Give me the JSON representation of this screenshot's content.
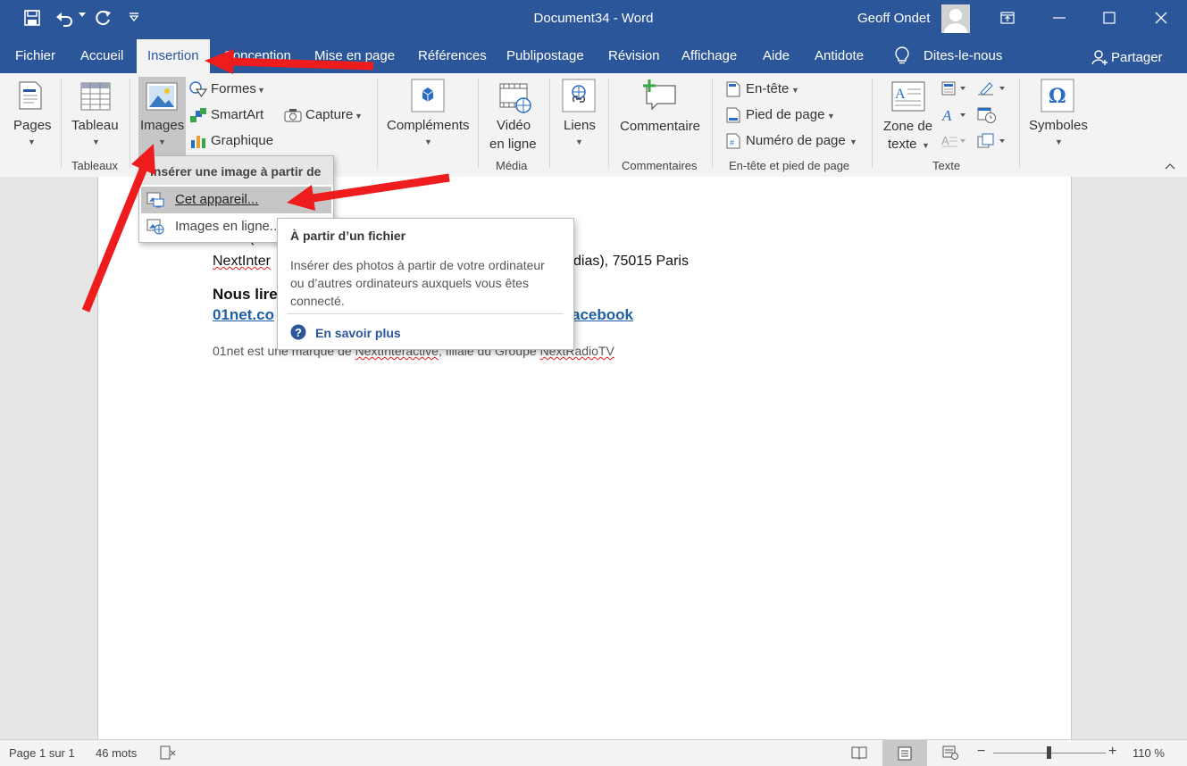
{
  "window": {
    "title": "Document34  -  Word",
    "user_name": "Geoff Ondet"
  },
  "menu_tabs": [
    "Fichier",
    "Accueil",
    "Insertion",
    "Conception",
    "Mise en page",
    "Références",
    "Publipostage",
    "Révision",
    "Affichage",
    "Aide",
    "Antidote"
  ],
  "active_tab": "Insertion",
  "tell_me": "Dites-le-nous",
  "share": "Partager",
  "ribbon": {
    "pages": "Pages",
    "tableau": "Tableau",
    "group_tableaux": "Tableaux",
    "images": "Images",
    "formes": "Formes",
    "smartart": "SmartArt",
    "capture": "Capture",
    "graphique": "Graphique",
    "complements": "Compléments",
    "video_line1": "Vidéo",
    "video_line2": "en ligne",
    "group_media": "Média",
    "liens": "Liens",
    "commentaire": "Commentaire",
    "group_commentaires": "Commentaires",
    "entete": "En-tête",
    "pied_de_page": "Pied de page",
    "numero_de_page": "Numéro de page",
    "group_entete": "En-tête et pied de page",
    "zone_line1": "Zone de",
    "zone_line2": "texte",
    "group_texte": "Texte",
    "symboles": "Symboles"
  },
  "images_dropdown": {
    "header": "Insérer une image à partir de",
    "items": [
      "Cet appareil...",
      "Images en ligne..."
    ]
  },
  "tooltip": {
    "title": "À partir d’un fichier",
    "body": "Insérer des photos à partir de votre ordinateur ou d’autres ordinateurs auxquels vous êtes connecté.",
    "link": "En savoir plus"
  },
  "document": {
    "line1": "T +33(0",
    "line2_start": "NextInter",
    "line2_end": "dias), 75015 Paris",
    "heading_start": "Nous lire",
    "link_start": "01net.co",
    "link_end": "acebook",
    "footer_pre": "01net est une marque de ",
    "footer_brand": "NextInteractive",
    "footer_mid": ", filiale du Groupe ",
    "footer_group": "NextRadioTV"
  },
  "status": {
    "page": "Page 1 sur 1",
    "words": "46 mots",
    "zoom": "110 %"
  },
  "colors": {
    "accent": "#2b579a",
    "annotation_arrow": "#ee1c1c",
    "link": "#1f5fa8"
  }
}
